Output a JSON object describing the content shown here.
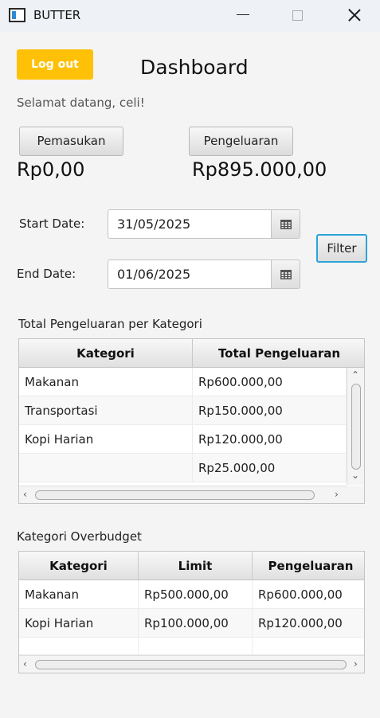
{
  "window": {
    "title": "BUTTER",
    "icon": "app-window-icon",
    "controls": [
      "minimize-icon",
      "maximize-icon",
      "close-icon"
    ]
  },
  "header": {
    "logout_label": "Log out",
    "title": "Dashboard",
    "welcome": "Selamat datang, celi!"
  },
  "summary": {
    "pemasukan_label": "Pemasukan",
    "pemasukan_value": "Rp0,00",
    "pengeluaran_label": "Pengeluaran",
    "pengeluaran_value": "Rp895.000,00"
  },
  "filter": {
    "start_label": "Start Date:",
    "start_value": "31/05/2025",
    "end_label": "End Date:",
    "end_value": "01/06/2025",
    "filter_label": "Filter",
    "calendar_icon": "calendar-icon"
  },
  "kategori_table": {
    "title": "Total Pengeluaran per Kategori",
    "headers": [
      "Kategori",
      "Total Pengeluaran"
    ],
    "rows": [
      [
        "Makanan",
        "Rp600.000,00"
      ],
      [
        "Transportasi",
        "Rp150.000,00"
      ],
      [
        "Kopi Harian",
        "Rp120.000,00"
      ],
      [
        "",
        "Rp25.000,00"
      ]
    ]
  },
  "overbudget_table": {
    "title": "Kategori Overbudget",
    "headers": [
      "Kategori",
      "Limit",
      "Pengeluaran"
    ],
    "rows": [
      [
        "Makanan",
        "Rp500.000,00",
        "Rp600.000,00"
      ],
      [
        "Kopi Harian",
        "Rp100.000,00",
        "Rp120.000,00"
      ]
    ]
  },
  "colors": {
    "accent": "#ffc107",
    "focus": "#2aa3d8",
    "background": "#f4f4f4"
  }
}
